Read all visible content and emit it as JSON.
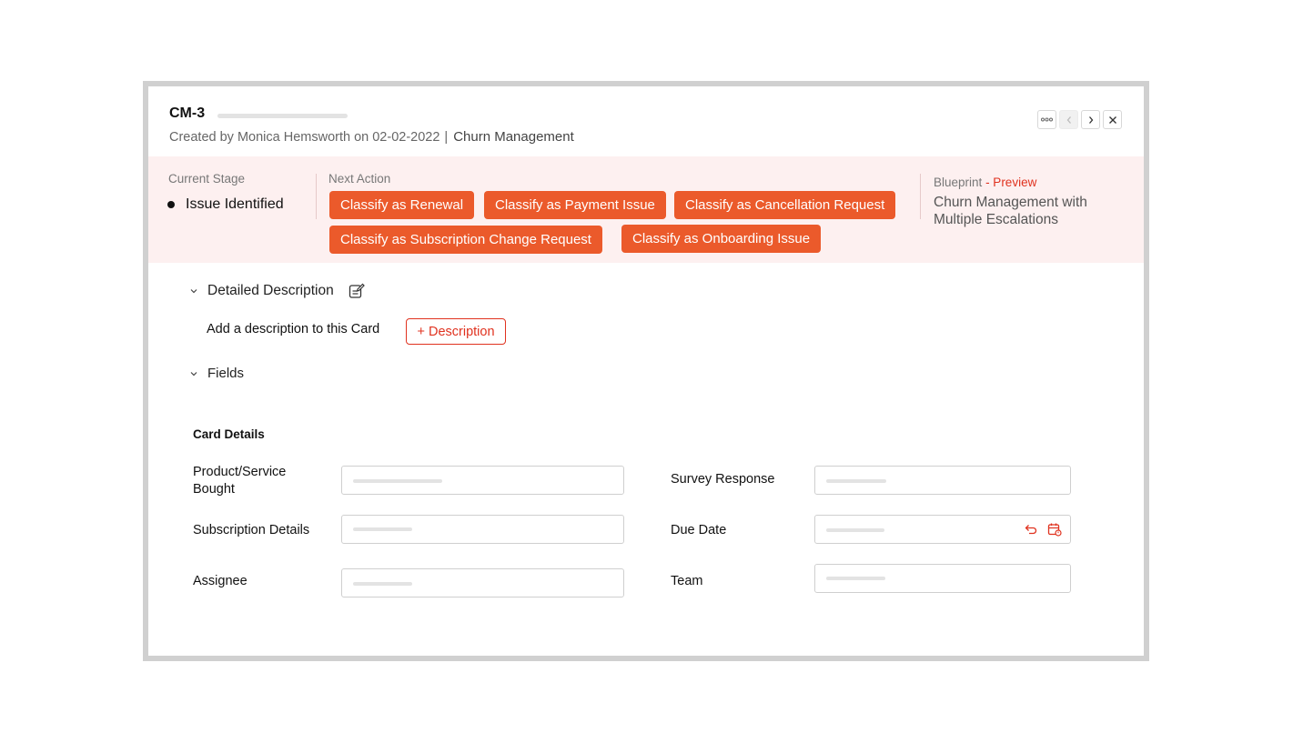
{
  "header": {
    "card_id": "CM-3",
    "created_by": "Created by Monica Hemsworth on 02-02-2022",
    "separator": "|",
    "pipeline": "Churn Management",
    "actions": [
      {
        "name": "more-icon"
      },
      {
        "name": "chevron-left-icon"
      },
      {
        "name": "chevron-right-icon"
      },
      {
        "name": "close-icon"
      }
    ]
  },
  "stage": {
    "current_label": "Current Stage",
    "current_value": "Issue Identified",
    "next_action_label": "Next Action",
    "actions": [
      "Classify as Renewal",
      "Classify as Payment Issue",
      "Classify as Cancellation Request",
      "Classify as Subscription Change Request",
      "Classify as Onboarding Issue"
    ],
    "blueprint_label": "Blueprint",
    "blueprint_preview": "- Preview",
    "blueprint_name": "Churn Management with Multiple Escalations"
  },
  "description": {
    "heading": "Detailed Description",
    "hint": "Add a description to this Card",
    "button": "+ Description"
  },
  "fields": {
    "heading": "Fields",
    "section": "Card Details",
    "items": [
      {
        "label": "Product/Service Bought"
      },
      {
        "label": "Survey Response"
      },
      {
        "label": "Subscription Details"
      },
      {
        "label": "Due Date"
      },
      {
        "label": "Assignee"
      },
      {
        "label": "Team"
      }
    ]
  },
  "colors": {
    "accent": "#eb5a2b",
    "danger": "#e0321f",
    "stage_band": "#fdf0f0"
  }
}
